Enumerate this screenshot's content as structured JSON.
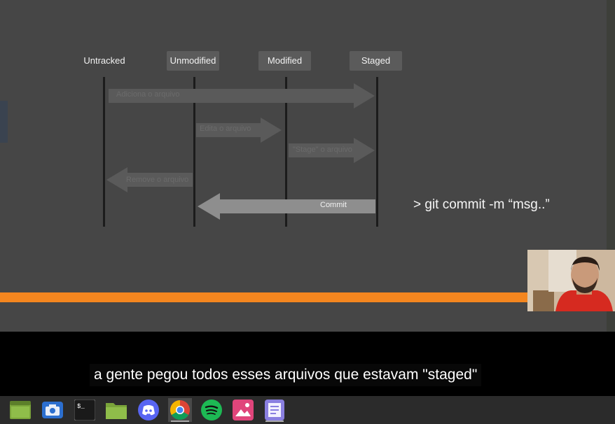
{
  "diagram": {
    "states": [
      "Untracked",
      "Unmodified",
      "Modified",
      "Staged"
    ],
    "arrows": [
      {
        "label": "Adiciona o arquivo",
        "from": "Untracked",
        "to": "Staged"
      },
      {
        "label": "Edita o arquivo",
        "from": "Unmodified",
        "to": "Modified"
      },
      {
        "label": "\"Stage\" o arquivo",
        "from": "Modified",
        "to": "Staged"
      },
      {
        "label": "Remove o arquivo",
        "from": "Unmodified",
        "to": "Untracked"
      },
      {
        "label": "Commit",
        "from": "Staged",
        "to": "Unmodified"
      }
    ],
    "command": "> git commit -m “msg..”"
  },
  "subtitle": "a gente pegou todos esses arquivos que estavam \"staged\"",
  "taskbar": {
    "icons": [
      "file-manager-icon",
      "screenshot-icon",
      "terminal-icon",
      "folder-icon",
      "discord-icon",
      "chrome-icon",
      "spotify-icon",
      "image-viewer-icon",
      "text-editor-icon"
    ],
    "active": "chrome-icon",
    "terminal_glyph": "$_"
  },
  "colors": {
    "slide_bg": "#464646",
    "accent_bar": "#f4861f",
    "state_box": "#5b5b5b",
    "arrow": "#5a5a5a",
    "caption_bg": "#080808"
  }
}
